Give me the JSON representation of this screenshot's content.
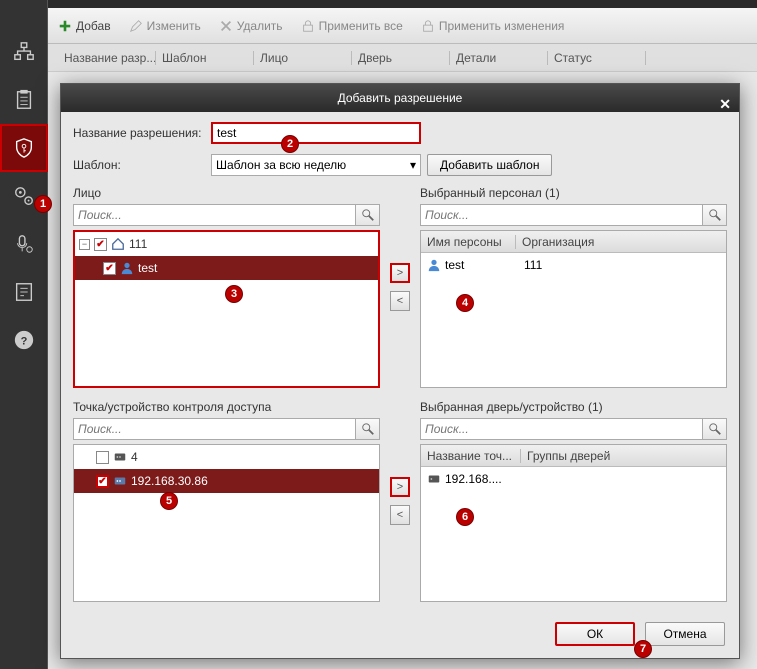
{
  "toolbar": {
    "add": "Добав",
    "edit": "Изменить",
    "delete": "Удалить",
    "apply_all": "Применить все",
    "apply_changes": "Применить изменения"
  },
  "columns": {
    "name": "Название разр...",
    "template": "Шаблон",
    "person": "Лицо",
    "door": "Дверь",
    "details": "Детали",
    "status": "Статус"
  },
  "dialog": {
    "title": "Добавить разрешение",
    "name_label": "Название разрешения:",
    "name_value": "test",
    "template_label": "Шаблон:",
    "template_value": "Шаблон за всю неделю",
    "add_template_btn": "Добавить шаблон",
    "person_section": "Лицо",
    "search_placeholder": "Поиск...",
    "org1": "111",
    "person1": "test",
    "selected_person_section": "Выбранный персонал (1)",
    "col_person_name": "Имя персоны",
    "col_org": "Организация",
    "sel_person": "test",
    "sel_org": "111",
    "device_section": "Точка/устройство контроля доступа",
    "dev1": "4",
    "dev2": "192.168.30.86",
    "selected_device_section": "Выбранная дверь/устройство (1)",
    "col_point": "Название точ...",
    "col_groups": "Группы дверей",
    "sel_dev": "192.168....",
    "ok": "ОК",
    "cancel": "Отмена"
  },
  "badges": [
    "1",
    "2",
    "3",
    "4",
    "5",
    "6",
    "7"
  ]
}
